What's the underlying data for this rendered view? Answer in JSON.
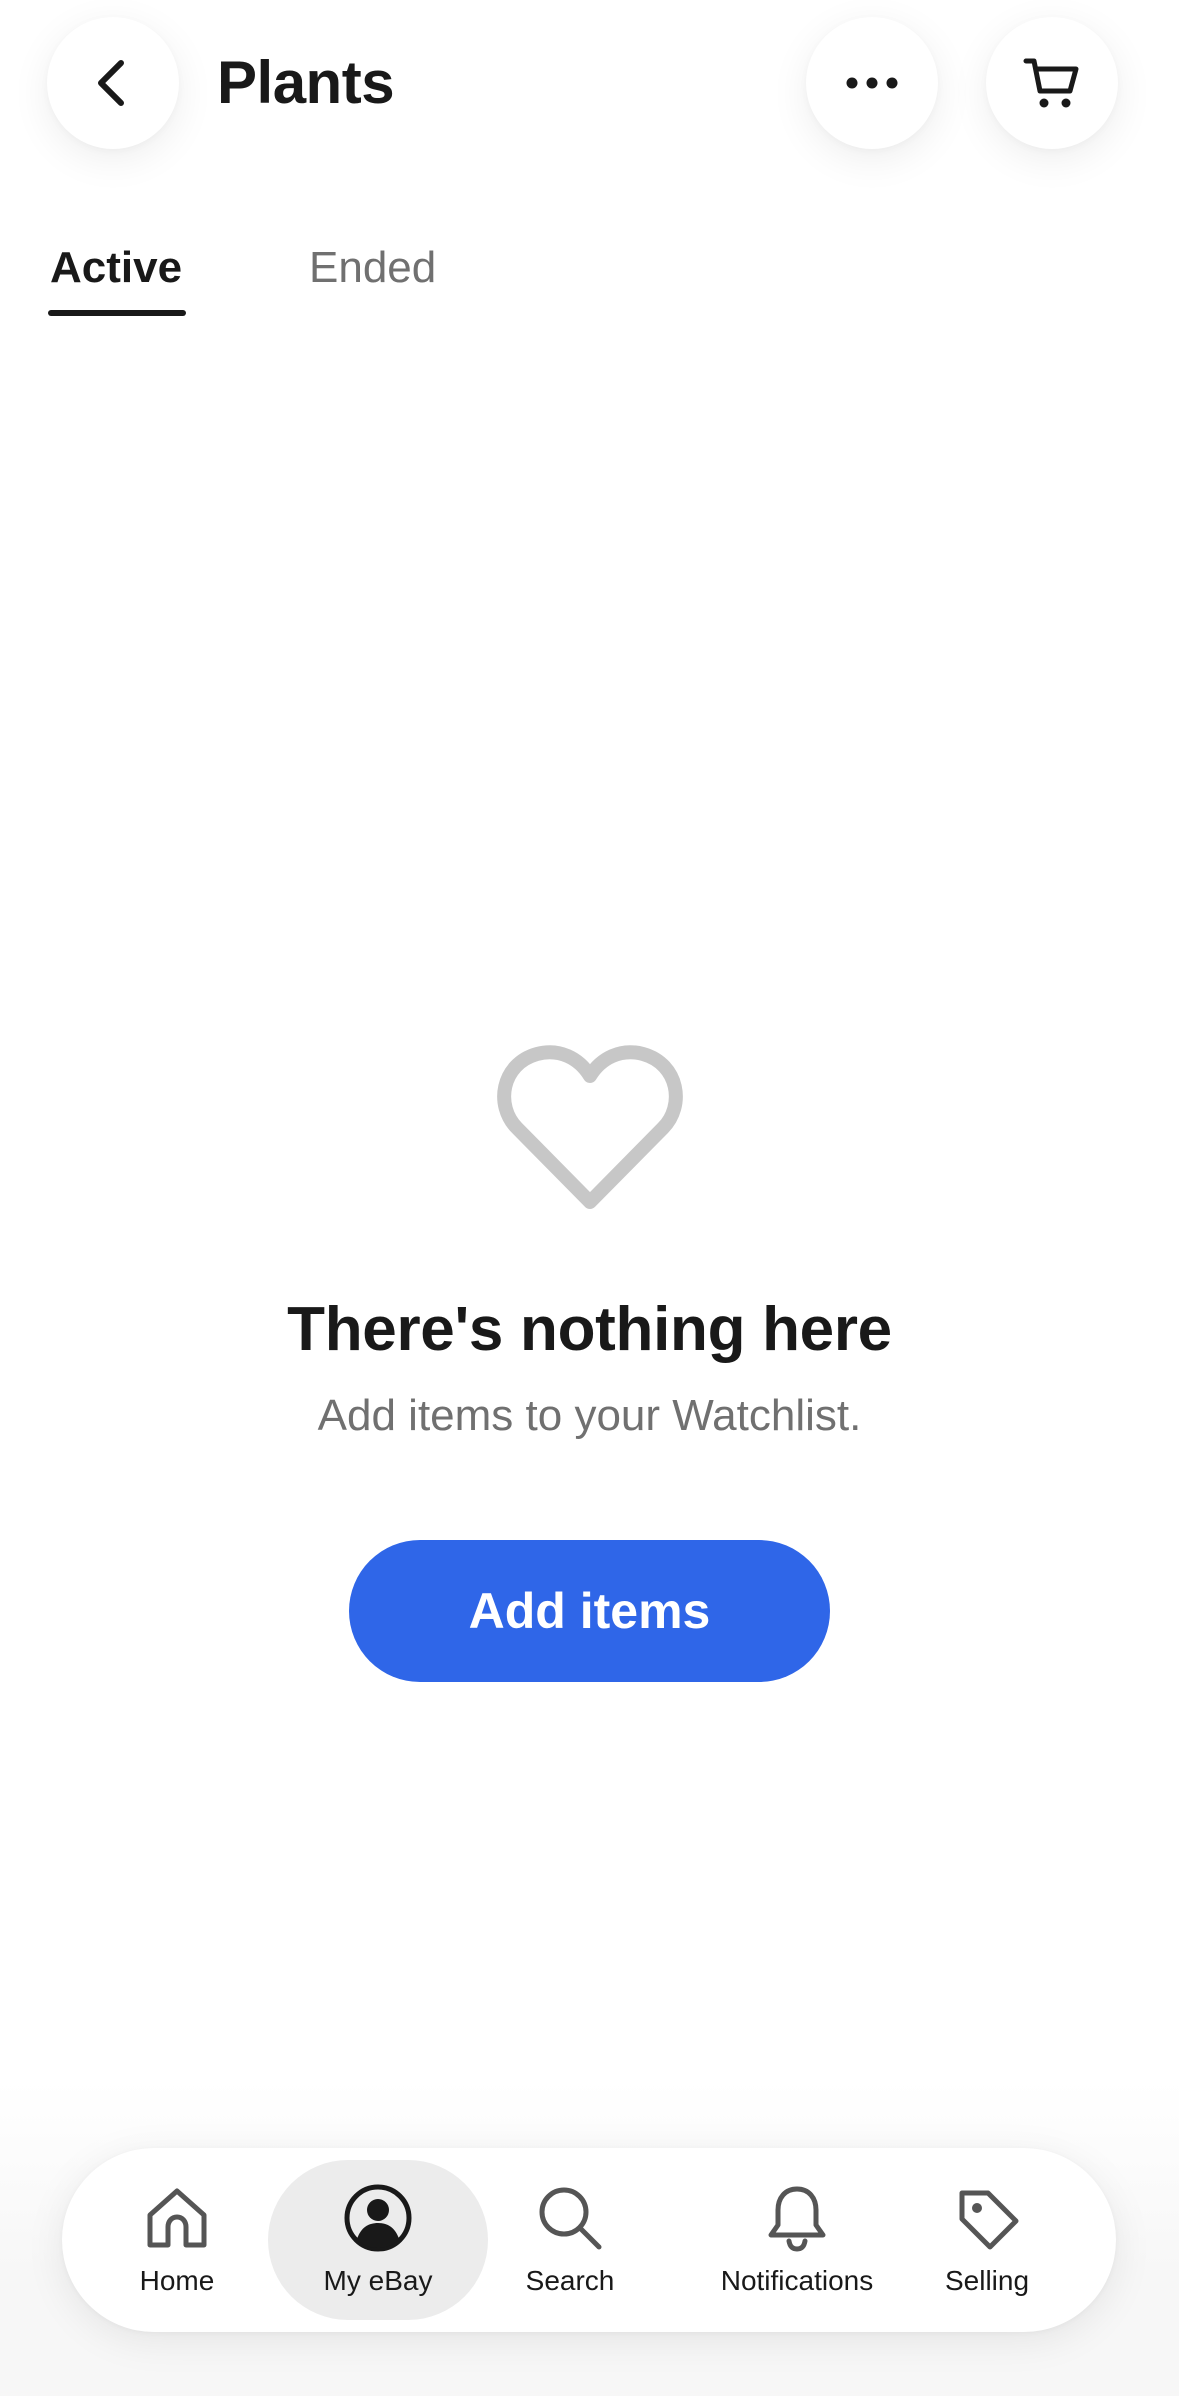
{
  "header": {
    "title": "Plants",
    "back_icon": "chevron-left-icon",
    "more_icon": "more-horizontal-icon",
    "cart_icon": "cart-icon"
  },
  "tabs": [
    {
      "label": "Active",
      "selected": true
    },
    {
      "label": "Ended",
      "selected": false
    }
  ],
  "empty_state": {
    "icon": "heart-outline-icon",
    "title": "There's nothing here",
    "subtitle": "Add items to your Watchlist.",
    "button_label": "Add items"
  },
  "bottom_nav": {
    "items": [
      {
        "label": "Home",
        "icon": "home-icon",
        "selected": false
      },
      {
        "label": "My eBay",
        "icon": "profile-icon",
        "selected": true
      },
      {
        "label": "Search",
        "icon": "search-icon",
        "selected": false
      },
      {
        "label": "Notifications",
        "icon": "bell-icon",
        "selected": false
      },
      {
        "label": "Selling",
        "icon": "tag-icon",
        "selected": false
      }
    ]
  },
  "colors": {
    "accent": "#2f66e8",
    "text_primary": "#191919",
    "text_secondary": "#707070",
    "icon_muted": "#c7c7c7",
    "selected_pill": "#ececec"
  }
}
